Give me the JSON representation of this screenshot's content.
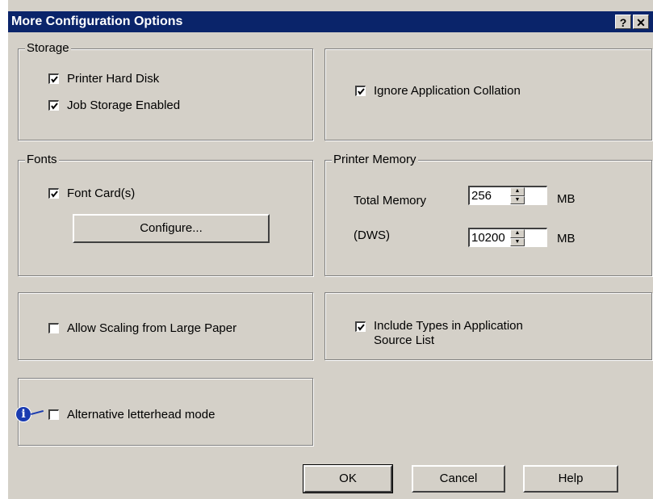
{
  "window": {
    "title": "More Configuration Options",
    "help_button": "?",
    "close_button": "✕"
  },
  "storage": {
    "legend": "Storage",
    "printer_hard_disk": {
      "label": "Printer Hard Disk",
      "checked": true
    },
    "job_storage": {
      "label": "Job Storage Enabled",
      "checked": true
    }
  },
  "collation": {
    "label": "Ignore Application Collation",
    "checked": true
  },
  "fonts": {
    "legend": "Fonts",
    "font_cards": {
      "label": "Font Card(s)",
      "checked": true
    },
    "configure_button": "Configure..."
  },
  "memory": {
    "legend": "Printer Memory",
    "total_label": "Total Memory",
    "total_value": "256",
    "dws_label": "(DWS)",
    "dws_value": "10200",
    "unit": "MB"
  },
  "scaling": {
    "label": "Allow Scaling from Large Paper",
    "checked": false
  },
  "types": {
    "label": "Include Types in Application Source List",
    "checked": true
  },
  "letterhead": {
    "label": "Alternative letterhead mode",
    "checked": false,
    "info_icon": "i"
  },
  "buttons": {
    "ok": "OK",
    "cancel": "Cancel",
    "help": "Help"
  }
}
